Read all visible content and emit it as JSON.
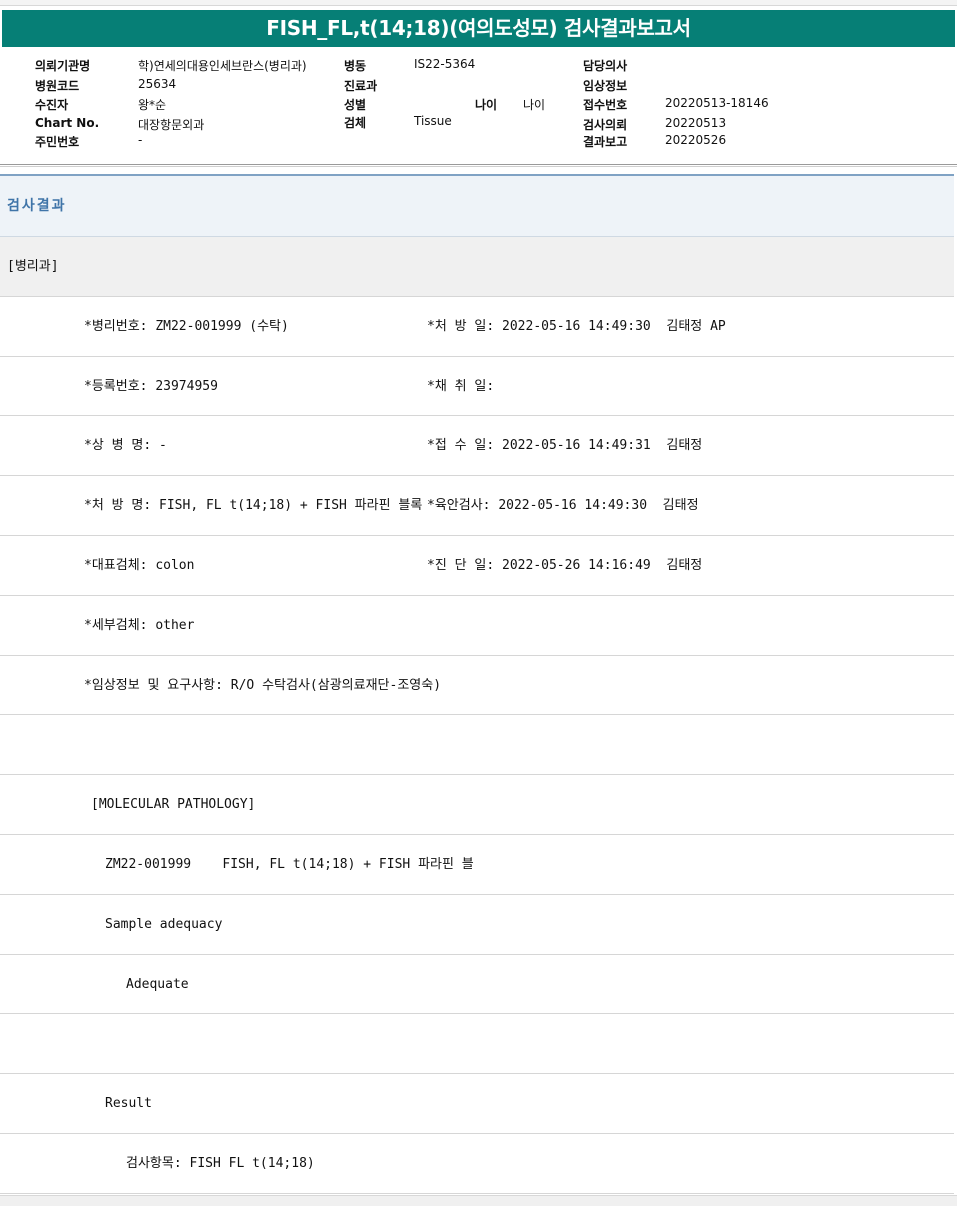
{
  "title": "FISH_FL,t(14;18)(여의도성모) 검사결과보고서",
  "header": {
    "labels": {
      "institution": "의뢰기관명",
      "hospital_code": "병원코드",
      "patient": "수진자",
      "chart_no": "Chart No.",
      "resident_no": "주민번호",
      "ward": "병동",
      "department": "진료과",
      "sex": "성별",
      "age": "나이",
      "specimen": "검체",
      "doctor": "담당의사",
      "clinical_info": "임상정보",
      "receipt_no": "접수번호",
      "request_date": "검사의뢰",
      "report_date": "결과보고"
    },
    "values": {
      "institution": "학)연세의대용인세브란스(병리과)",
      "hospital_code": "25634",
      "patient": "왕*순",
      "chart_no": "대장항문외과",
      "resident_no": "-",
      "ward": "IS22-5364",
      "age": "나이",
      "specimen": "Tissue",
      "receipt_no": "20220513-18146",
      "request_date": "20220513",
      "report_date": "20220526"
    }
  },
  "section_title": "검사결과",
  "report": {
    "department": "[병리과]",
    "path_no": "*병리번호: ZM22-001999 (수탁)",
    "prescribe_date": "*처 방 일: 2022-05-16 14:49:30  김태정 AP",
    "reg_no": "*등록번호: 23974959",
    "collect_date": "*채 취 일:",
    "diagnosis_name": "*상 병 명: -",
    "receipt_date": "*접 수 일: 2022-05-16 14:49:31  김태정",
    "order_name": "*처 방 명: FISH, FL t(14;18) + FISH 파라핀 블록",
    "gross_exam": "*육안검사: 2022-05-16 14:49:30  김태정",
    "main_specimen": "*대표검체: colon",
    "diagnosis_date": "*진 단 일: 2022-05-26 14:16:49  김태정",
    "sub_specimen": "*세부검체: other",
    "clinical_request": "*임상정보 및 요구사항: R/O 수탁검사(삼광의료재단-조영숙)",
    "mol_path": "[MOLECULAR PATHOLOGY]",
    "case_line": "ZM22-001999    FISH, FL t(14;18) + FISH 파라핀 블",
    "adequacy_label": "Sample adequacy",
    "adequacy_value": "Adequate",
    "result_label": "Result",
    "test_item": "검사항목: FISH FL t(14;18)"
  },
  "colors": {
    "title_bar": "#067f76",
    "section_text": "#3f74a8",
    "section_bg": "#eef3f8"
  }
}
